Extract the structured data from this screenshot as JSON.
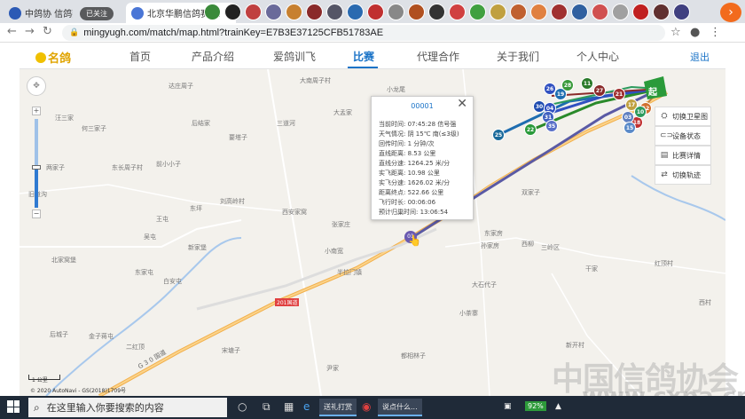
{
  "browser": {
    "tabs": [
      {
        "title": "中鸽协 信鸽赛",
        "active": false
      },
      {
        "title": "已关注",
        "active": true
      },
      {
        "title": "北京华鹏信鸽赛鸽公",
        "active": false
      }
    ],
    "follow_label": "已关注",
    "url": "mingyugh.com/match/map.html?trainKey=E7B3E37125CFB51783AE"
  },
  "site": {
    "logo": "名鸽",
    "nav": [
      "首页",
      "产品介绍",
      "爱鸽训飞",
      "比赛",
      "代理合作",
      "关于我们",
      "个人中心"
    ],
    "active_nav": "比赛",
    "logout": "退出"
  },
  "map": {
    "places": [
      {
        "name": "达庄周子",
        "id": "p1"
      },
      {
        "name": "大南周子村",
        "id": "p2"
      },
      {
        "name": "小龙尾",
        "id": "p3"
      },
      {
        "name": "汪三家",
        "id": "p4"
      },
      {
        "name": "何三家子",
        "id": "p5"
      },
      {
        "name": "后结家",
        "id": "p6"
      },
      {
        "name": "三道河",
        "id": "p7"
      },
      {
        "name": "大孟家",
        "id": "p8"
      },
      {
        "name": "要塔子",
        "id": "p9"
      },
      {
        "name": "两家子",
        "id": "p10"
      },
      {
        "name": "东长周子村",
        "id": "p11"
      },
      {
        "name": "前小小子",
        "id": "p12"
      },
      {
        "name": "旧道沟",
        "id": "p13"
      },
      {
        "name": "东坪",
        "id": "p14"
      },
      {
        "name": "刘高岭村",
        "id": "p15"
      },
      {
        "name": "西安家窝",
        "id": "p16"
      },
      {
        "name": "张家庄",
        "id": "p17"
      },
      {
        "name": "王屯",
        "id": "p18"
      },
      {
        "name": "吴屯",
        "id": "p19"
      },
      {
        "name": "新家堡",
        "id": "p20"
      },
      {
        "name": "小南宽",
        "id": "p21"
      },
      {
        "name": "半拉门镇",
        "id": "p22"
      },
      {
        "name": "北家窝堡",
        "id": "p23"
      },
      {
        "name": "东家屯",
        "id": "p24"
      },
      {
        "name": "白安屯",
        "id": "p25"
      },
      {
        "name": "后城子",
        "id": "p26"
      },
      {
        "name": "金子蒋屯",
        "id": "p27"
      },
      {
        "name": "二红顶",
        "id": "p28"
      },
      {
        "name": "宋塘子",
        "id": "p29"
      },
      {
        "name": "孙家房",
        "id": "p30"
      },
      {
        "name": "西柳",
        "id": "p31"
      },
      {
        "name": "三岭区",
        "id": "p32"
      },
      {
        "name": "红顶村",
        "id": "p33"
      },
      {
        "name": "西村",
        "id": "p34"
      },
      {
        "name": "大石代子",
        "id": "p35"
      },
      {
        "name": "小茶寨",
        "id": "p36"
      },
      {
        "name": "都相林子",
        "id": "p37"
      },
      {
        "name": "尹家",
        "id": "p38"
      },
      {
        "name": "新开村",
        "id": "p39"
      },
      {
        "name": "干家",
        "id": "p40"
      },
      {
        "name": "双家子",
        "id": "p41"
      },
      {
        "name": "东家房",
        "id": "p42"
      }
    ],
    "road_label": "G 3 0 国道",
    "road_label_2": "201国道",
    "scale": "1 公里",
    "copyright": "© 2020 AutoNavi - GS(2018)1709号",
    "start_marker": "起",
    "bird_markers": [
      "25",
      "22",
      "19",
      "30",
      "04",
      "31",
      "35",
      "27",
      "21",
      "17",
      "12",
      "18",
      "26",
      "28",
      "11",
      "03",
      "15",
      "10"
    ],
    "selected_marker": "01",
    "info": {
      "title": "00001",
      "rows": [
        {
          "label": "当前时间:",
          "value": "07:45:28 信号强"
        },
        {
          "label": "天气情况:",
          "value": "阴 15℃ 南(≤3级)"
        },
        {
          "label": "回传时间:",
          "value": "1 分钟/次"
        },
        {
          "label": "直线距离:",
          "value": "8.53 公里"
        },
        {
          "label": "直线分速:",
          "value": "1264.25 米/分"
        },
        {
          "label": "实飞距离:",
          "value": "10.98 公里"
        },
        {
          "label": "实飞分速:",
          "value": "1626.02 米/分"
        },
        {
          "label": "距离终点:",
          "value": "522.66 公里"
        },
        {
          "label": "飞行时长:",
          "value": "00:06:06"
        },
        {
          "label": "预计归巢时间:",
          "value": "13:06:54"
        }
      ]
    },
    "controls": [
      {
        "label": "切换卫星图",
        "icon": "satellite-icon"
      },
      {
        "label": "设备状态",
        "icon": "toggle-icon"
      },
      {
        "label": "比赛详情",
        "icon": "document-icon"
      },
      {
        "label": "切换轨迹",
        "icon": "swap-icon"
      }
    ]
  },
  "watermark": {
    "line1": "中国信鸽协会",
    "line2": "www.chinacxpa.cn"
  },
  "taskbar": {
    "search_placeholder": "在这里输入你要搜索的内容",
    "pill1": "送礼打赏",
    "pill2": "说点什么...",
    "battery": "92%"
  }
}
